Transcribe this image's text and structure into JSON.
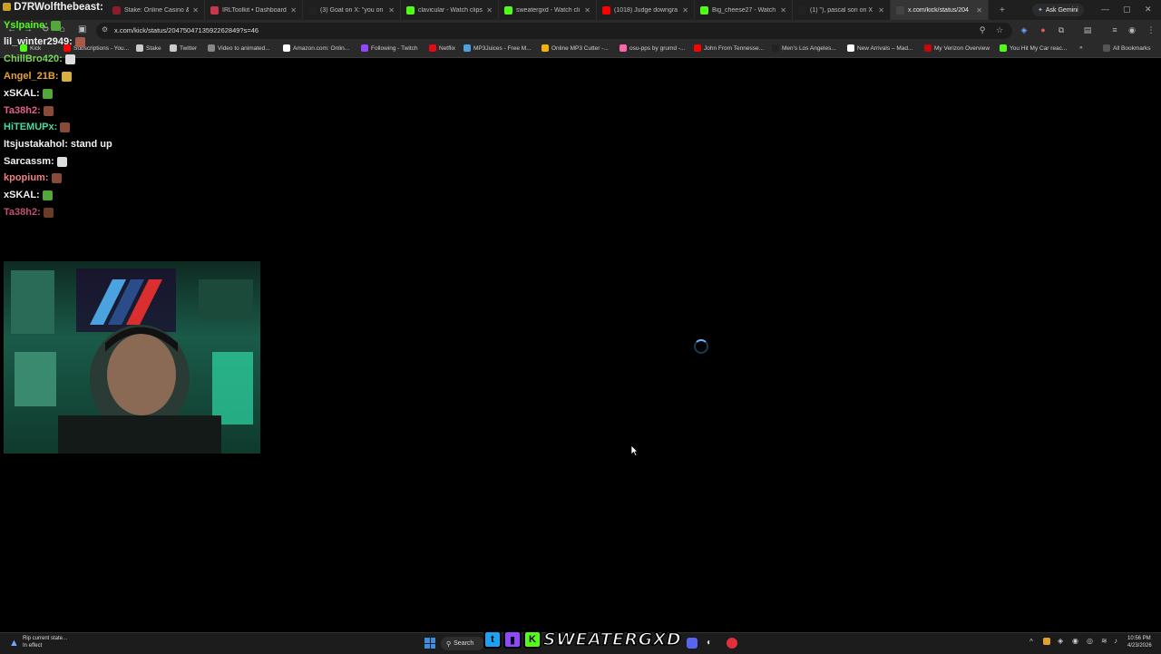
{
  "tabs": [
    {
      "title": "Stake: Online Casino &",
      "color": "#8a1c2b"
    },
    {
      "title": "IRLToolkit • Dashboard",
      "color": "#c9374a"
    },
    {
      "title": "(3) Goat on X: \"you on",
      "color": "#222222"
    },
    {
      "title": "clavicular - Watch clips",
      "color": "#53fc18"
    },
    {
      "title": "sweatergxd - Watch cli",
      "color": "#53fc18"
    },
    {
      "title": "(1018) Judge downgra",
      "color": "#ff0000"
    },
    {
      "title": "Big_cheese27 - Watch",
      "color": "#53fc18"
    },
    {
      "title": "(1) \"), pascal son on X",
      "color": "#222222"
    },
    {
      "title": "x.com/kick/status/204",
      "color": "#444444",
      "active": true
    }
  ],
  "gemini_label": "Ask Gemini",
  "address_url": "x.com/kick/status/2047504713592262849?s=46",
  "bookmarks": [
    {
      "label": "Kick",
      "color": "#53fc18"
    },
    {
      "label": "Subscriptions - You...",
      "color": "#ff0000"
    },
    {
      "label": "Stake",
      "color": "#cccccc"
    },
    {
      "label": "Twitter",
      "color": "#cccccc"
    },
    {
      "label": "Video to animated...",
      "color": "#888888"
    },
    {
      "label": "Amazon.com: Onlin...",
      "color": "#ffffff"
    },
    {
      "label": "Following - Twitch",
      "color": "#9146ff"
    },
    {
      "label": "Netflix",
      "color": "#e50914"
    },
    {
      "label": "MP3Juices - Free M...",
      "color": "#4aa3df"
    },
    {
      "label": "Online MP3 Cutter -...",
      "color": "#f4b400"
    },
    {
      "label": "osu-pps by grumd -...",
      "color": "#ff66aa"
    },
    {
      "label": "John From Tennesse...",
      "color": "#ff0000"
    },
    {
      "label": "Men's Los Angeles...",
      "color": "#222222"
    },
    {
      "label": "New Arrivals – Mad...",
      "color": "#ffffff"
    },
    {
      "label": "My Verizon Overview",
      "color": "#cd040b"
    },
    {
      "label": "You Hit My Car reac...",
      "color": "#53fc18"
    }
  ],
  "all_bookmarks_label": "All Bookmarks",
  "chat": {
    "header_user": "D7RWolfthebeast:",
    "lines": [
      {
        "user": "Yslpaine:",
        "color": "#53fc18",
        "message": "",
        "emote": "#53a83a"
      },
      {
        "user": "lil_winter2949:",
        "color": "#f0f0f0",
        "message": "",
        "emote": "#a85a4a"
      },
      {
        "user": "ChillBro420:",
        "color": "#7ad957",
        "message": "",
        "emote": "#dddddd"
      },
      {
        "user": "Angel_21B:",
        "color": "#e8a23a",
        "message": "",
        "emote": "#d9b040"
      },
      {
        "user": "xSKAL:",
        "color": "#f0f0f0",
        "message": "",
        "emote": "#53a83a"
      },
      {
        "user": "Ta38h2:",
        "color": "#e0608a",
        "message": "",
        "emote": "#8a4a3a"
      },
      {
        "user": "HiTEMUPx:",
        "color": "#4ad9a0",
        "message": "",
        "emote": "#8a4a3a"
      },
      {
        "user": "Itsjustakahol:",
        "color": "#f0f0f0",
        "message": "stand up",
        "emote": ""
      },
      {
        "user": "Sarcassm:",
        "color": "#f0f0f0",
        "message": "",
        "emote": "#dddddd"
      },
      {
        "user": "kpopium:",
        "color": "#f08080",
        "message": "",
        "emote": "#8a4a3a"
      },
      {
        "user": "xSKAL:",
        "color": "#f0f0f0",
        "message": "",
        "emote": "#53a83a"
      },
      {
        "user": "Ta38h2:",
        "color": "#c05070",
        "message": "",
        "emote": "#6a3a2a"
      }
    ]
  },
  "taskbar": {
    "notification_title": "Rip current state...",
    "notification_sub": "In effect",
    "search_label": "Search",
    "brand_text": "SWEATERGXD",
    "time": "10:56 PM",
    "date": "4/23/2026"
  }
}
